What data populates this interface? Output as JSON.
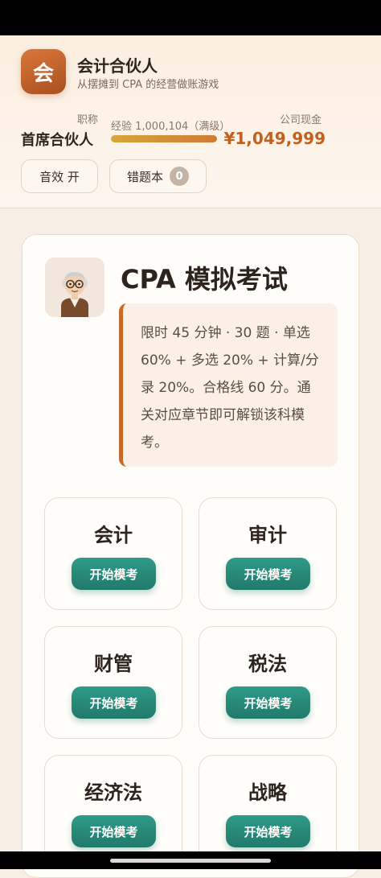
{
  "header": {
    "logo_text": "会",
    "app_title": "会计合伙人",
    "app_subtitle": "从摆摊到 CPA 的经营做账游戏",
    "title_label": "职称",
    "title_value": "首席合伙人",
    "exp_label": "经验 1,000,104（满级）",
    "exp_progress": 1.0,
    "cash_label": "公司现金",
    "cash_value": "¥1,049,999",
    "sound_button": "音效 开",
    "wrong_book_button": "错题本",
    "wrong_book_count": "0"
  },
  "exam": {
    "avatar_icon": "professor-avatar-icon",
    "title": "CPA 模拟考试",
    "description": "限时 45 分钟 · 30 题 · 单选 60% + 多选 20% + 计算/分录 20%。合格线 60 分。通关对应章节即可解锁该科模考。",
    "subjects": [
      {
        "name": "会计",
        "button": "开始模考"
      },
      {
        "name": "审计",
        "button": "开始模考"
      },
      {
        "name": "财管",
        "button": "开始模考"
      },
      {
        "name": "税法",
        "button": "开始模考"
      },
      {
        "name": "经济法",
        "button": "开始模考"
      },
      {
        "name": "战略",
        "button": "开始模考"
      }
    ]
  },
  "colors": {
    "accent": "#c9692a",
    "cash": "#c2611f",
    "button": "#217a6b"
  }
}
